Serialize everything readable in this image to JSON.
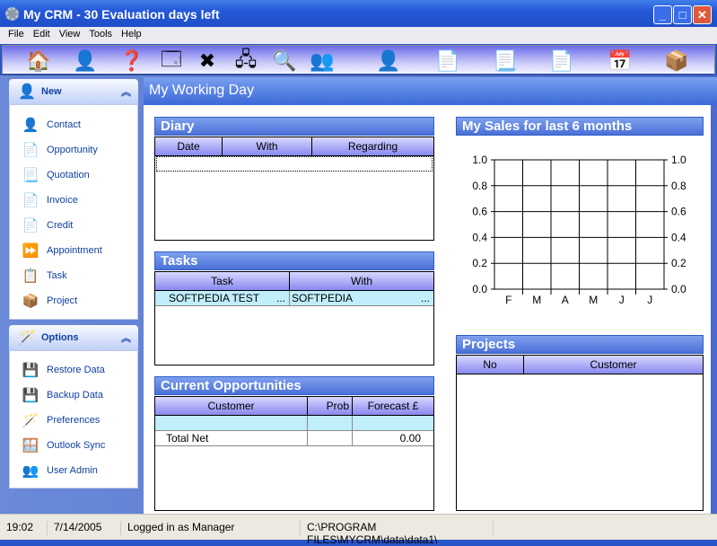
{
  "window": {
    "title": "My CRM - 30 Evaluation days left",
    "min": "_",
    "max": "□",
    "close": "✕"
  },
  "menu": [
    "File",
    "Edit",
    "View",
    "Tools",
    "Help"
  ],
  "toolbar": [
    {
      "icon": "home-icon",
      "glyph": "🏠"
    },
    {
      "icon": "add-user-icon",
      "glyph": "👤"
    },
    {
      "icon": "help-icon",
      "glyph": "❓"
    },
    {
      "icon": "window-icon",
      "glyph": "🗔"
    },
    {
      "icon": "excel-icon",
      "glyph": "✖"
    },
    {
      "icon": "network-icon",
      "glyph": "🖧"
    },
    {
      "icon": "search-icon",
      "glyph": "🔍"
    },
    {
      "icon": "users-icon",
      "glyph": "👥"
    },
    {
      "icon": "contact-icon",
      "glyph": "👤"
    },
    {
      "icon": "opportunity-icon",
      "glyph": "📄"
    },
    {
      "icon": "quotation-icon",
      "glyph": "📃"
    },
    {
      "icon": "invoice-icon",
      "glyph": "📄"
    },
    {
      "icon": "calendar-icon",
      "glyph": "📅"
    },
    {
      "icon": "project-icon",
      "glyph": "📦"
    }
  ],
  "sidebar": {
    "new": {
      "title": "New",
      "items": [
        {
          "label": "Contact",
          "glyph": "👤",
          "color": "#2050c0"
        },
        {
          "label": "Opportunity",
          "glyph": "📄",
          "color": "#e0b020"
        },
        {
          "label": "Quotation",
          "glyph": "📃",
          "color": "#e0a020"
        },
        {
          "label": "Invoice",
          "glyph": "📄",
          "color": "#8090d0"
        },
        {
          "label": "Credit",
          "glyph": "📄",
          "color": "#e04020"
        },
        {
          "label": "Appointment",
          "glyph": "⏩",
          "color": "#20a020"
        },
        {
          "label": "Task",
          "glyph": "📋",
          "color": "#606060"
        },
        {
          "label": "Project",
          "glyph": "📦",
          "color": "#e0a020"
        }
      ]
    },
    "options": {
      "title": "Options",
      "items": [
        {
          "label": "Restore Data",
          "glyph": "💾",
          "color": "#2060d0"
        },
        {
          "label": "Backup Data",
          "glyph": "💾",
          "color": "#2060d0"
        },
        {
          "label": "Preferences",
          "glyph": "🪄",
          "color": "#d04020"
        },
        {
          "label": "Outlook Sync",
          "glyph": "🪟",
          "color": "#e09020"
        },
        {
          "label": "User Admin",
          "glyph": "👥",
          "color": "#d08020"
        }
      ]
    }
  },
  "main": {
    "title": "My Working Day",
    "diary": {
      "title": "Diary",
      "columns": [
        "Date",
        "With",
        "Regarding"
      ]
    },
    "tasks": {
      "title": "Tasks",
      "columns": [
        "Task",
        "With"
      ],
      "rows": [
        [
          "SOFTPEDIA TEST",
          "SOFTPEDIA"
        ]
      ],
      "ellipsis": "..."
    },
    "opportunities": {
      "title": "Current Opportunities",
      "columns": [
        "Customer",
        "Prob",
        "Forecast £"
      ],
      "total_label": "Total Net",
      "total_value": "0.00"
    },
    "sales": {
      "title": "My Sales for last 6 months"
    },
    "projects": {
      "title": "Projects",
      "columns": [
        "No",
        "Customer"
      ]
    }
  },
  "chart_data": {
    "type": "line",
    "title": "My Sales for last 6 months",
    "categories": [
      "F",
      "M",
      "A",
      "M",
      "J",
      "J"
    ],
    "series": [],
    "ylim": [
      0,
      1.0
    ],
    "yticks": [
      "0.0",
      "0.2",
      "0.4",
      "0.6",
      "0.8",
      "1.0"
    ],
    "grid": true
  },
  "status": {
    "time": "19:02",
    "date": "7/14/2005",
    "user": "Logged in as Manager",
    "path": "C:\\PROGRAM FILES\\MYCRM\\data\\data1\\"
  }
}
